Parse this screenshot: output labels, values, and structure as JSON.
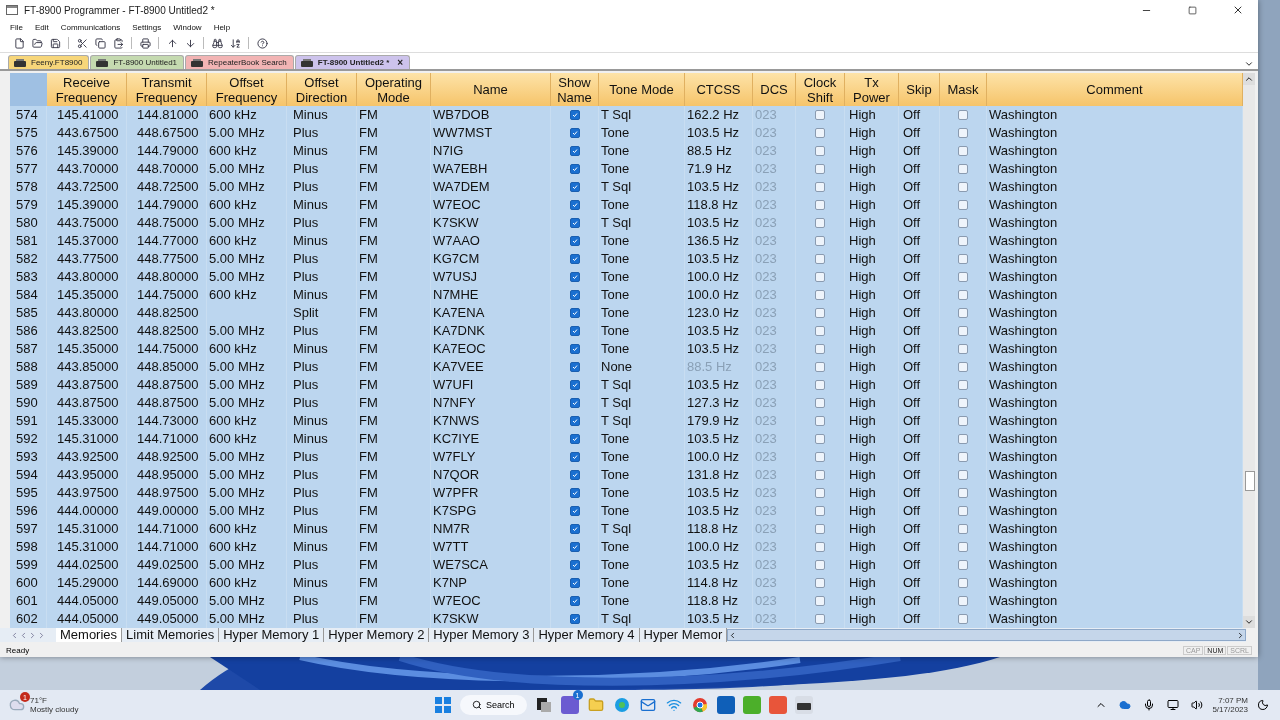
{
  "window": {
    "title": "FT-8900 Programmer - FT-8900 Untitled2 *"
  },
  "menu": [
    "File",
    "Edit",
    "Communications",
    "Settings",
    "Window",
    "Help"
  ],
  "doc_tabs": [
    {
      "label": "Feeny.FT8900",
      "color": "#f7d67a",
      "selected": false,
      "closable": false
    },
    {
      "label": "FT-8900 Untitled1",
      "color": "#c5dab0",
      "selected": false,
      "closable": false
    },
    {
      "label": "RepeaterBook Search",
      "color": "#f2b4b4",
      "selected": false,
      "closable": false
    },
    {
      "label": "FT-8900 Untitled2 *",
      "color": "#cdc3ec",
      "selected": true,
      "closable": true,
      "close": "×"
    }
  ],
  "table": {
    "columns": [
      "Receive Frequency",
      "Transmit Frequency",
      "Offset Frequency",
      "Offset Direction",
      "Operating Mode",
      "Name",
      "Show Name",
      "Tone Mode",
      "CTCSS",
      "DCS",
      "Clock Shift",
      "Tx Power",
      "Skip",
      "Mask",
      "Comment"
    ],
    "rows": [
      {
        "num": "574",
        "rx": "145.41000",
        "tx": "144.81000",
        "offset": "600 kHz",
        "direction": "Minus",
        "mode": "FM",
        "name": "WB7DOB",
        "show_name": true,
        "tone_mode": "T Sql",
        "ctcss": "162.2 Hz",
        "ctcss_enabled": true,
        "dcs": "023",
        "dcs_enabled": false,
        "clock_shift": false,
        "power": "High",
        "skip": "Off",
        "mask": false,
        "comment": "Washington"
      },
      {
        "num": "575",
        "rx": "443.67500",
        "tx": "448.67500",
        "offset": "5.00 MHz",
        "direction": "Plus",
        "mode": "FM",
        "name": "WW7MST",
        "show_name": true,
        "tone_mode": "Tone",
        "ctcss": "103.5 Hz",
        "ctcss_enabled": true,
        "dcs": "023",
        "dcs_enabled": false,
        "clock_shift": false,
        "power": "High",
        "skip": "Off",
        "mask": false,
        "comment": "Washington"
      },
      {
        "num": "576",
        "rx": "145.39000",
        "tx": "144.79000",
        "offset": "600 kHz",
        "direction": "Minus",
        "mode": "FM",
        "name": "N7IG",
        "show_name": true,
        "tone_mode": "Tone",
        "ctcss": "88.5 Hz",
        "ctcss_enabled": true,
        "dcs": "023",
        "dcs_enabled": false,
        "clock_shift": false,
        "power": "High",
        "skip": "Off",
        "mask": false,
        "comment": "Washington"
      },
      {
        "num": "577",
        "rx": "443.70000",
        "tx": "448.70000",
        "offset": "5.00 MHz",
        "direction": "Plus",
        "mode": "FM",
        "name": "WA7EBH",
        "show_name": true,
        "tone_mode": "Tone",
        "ctcss": "71.9 Hz",
        "ctcss_enabled": true,
        "dcs": "023",
        "dcs_enabled": false,
        "clock_shift": false,
        "power": "High",
        "skip": "Off",
        "mask": false,
        "comment": "Washington"
      },
      {
        "num": "578",
        "rx": "443.72500",
        "tx": "448.72500",
        "offset": "5.00 MHz",
        "direction": "Plus",
        "mode": "FM",
        "name": "WA7DEM",
        "show_name": true,
        "tone_mode": "T Sql",
        "ctcss": "103.5 Hz",
        "ctcss_enabled": true,
        "dcs": "023",
        "dcs_enabled": false,
        "clock_shift": false,
        "power": "High",
        "skip": "Off",
        "mask": false,
        "comment": "Washington"
      },
      {
        "num": "579",
        "rx": "145.39000",
        "tx": "144.79000",
        "offset": "600 kHz",
        "direction": "Minus",
        "mode": "FM",
        "name": "W7EOC",
        "show_name": true,
        "tone_mode": "Tone",
        "ctcss": "118.8 Hz",
        "ctcss_enabled": true,
        "dcs": "023",
        "dcs_enabled": false,
        "clock_shift": false,
        "power": "High",
        "skip": "Off",
        "mask": false,
        "comment": "Washington"
      },
      {
        "num": "580",
        "rx": "443.75000",
        "tx": "448.75000",
        "offset": "5.00 MHz",
        "direction": "Plus",
        "mode": "FM",
        "name": "K7SKW",
        "show_name": true,
        "tone_mode": "T Sql",
        "ctcss": "103.5 Hz",
        "ctcss_enabled": true,
        "dcs": "023",
        "dcs_enabled": false,
        "clock_shift": false,
        "power": "High",
        "skip": "Off",
        "mask": false,
        "comment": "Washington"
      },
      {
        "num": "581",
        "rx": "145.37000",
        "tx": "144.77000",
        "offset": "600 kHz",
        "direction": "Minus",
        "mode": "FM",
        "name": "W7AAO",
        "show_name": true,
        "tone_mode": "Tone",
        "ctcss": "136.5 Hz",
        "ctcss_enabled": true,
        "dcs": "023",
        "dcs_enabled": false,
        "clock_shift": false,
        "power": "High",
        "skip": "Off",
        "mask": false,
        "comment": "Washington"
      },
      {
        "num": "582",
        "rx": "443.77500",
        "tx": "448.77500",
        "offset": "5.00 MHz",
        "direction": "Plus",
        "mode": "FM",
        "name": "KG7CM",
        "show_name": true,
        "tone_mode": "Tone",
        "ctcss": "103.5 Hz",
        "ctcss_enabled": true,
        "dcs": "023",
        "dcs_enabled": false,
        "clock_shift": false,
        "power": "High",
        "skip": "Off",
        "mask": false,
        "comment": "Washington"
      },
      {
        "num": "583",
        "rx": "443.80000",
        "tx": "448.80000",
        "offset": "5.00 MHz",
        "direction": "Plus",
        "mode": "FM",
        "name": "W7USJ",
        "show_name": true,
        "tone_mode": "Tone",
        "ctcss": "100.0 Hz",
        "ctcss_enabled": true,
        "dcs": "023",
        "dcs_enabled": false,
        "clock_shift": false,
        "power": "High",
        "skip": "Off",
        "mask": false,
        "comment": "Washington"
      },
      {
        "num": "584",
        "rx": "145.35000",
        "tx": "144.75000",
        "offset": "600 kHz",
        "direction": "Minus",
        "mode": "FM",
        "name": "N7MHE",
        "show_name": true,
        "tone_mode": "Tone",
        "ctcss": "100.0 Hz",
        "ctcss_enabled": true,
        "dcs": "023",
        "dcs_enabled": false,
        "clock_shift": false,
        "power": "High",
        "skip": "Off",
        "mask": false,
        "comment": "Washington"
      },
      {
        "num": "585",
        "rx": "443.80000",
        "tx": "448.82500",
        "direction": "Split",
        "mode": "FM",
        "name": "KA7ENA",
        "show_name": true,
        "tone_mode": "Tone",
        "ctcss": "123.0 Hz",
        "ctcss_enabled": true,
        "dcs": "023",
        "dcs_enabled": false,
        "clock_shift": false,
        "power": "High",
        "skip": "Off",
        "mask": false,
        "comment": "Washington"
      },
      {
        "num": "586",
        "rx": "443.82500",
        "tx": "448.82500",
        "offset": "5.00 MHz",
        "direction": "Plus",
        "mode": "FM",
        "name": "KA7DNK",
        "show_name": true,
        "tone_mode": "Tone",
        "ctcss": "103.5 Hz",
        "ctcss_enabled": true,
        "dcs": "023",
        "dcs_enabled": false,
        "clock_shift": false,
        "power": "High",
        "skip": "Off",
        "mask": false,
        "comment": "Washington"
      },
      {
        "num": "587",
        "rx": "145.35000",
        "tx": "144.75000",
        "offset": "600 kHz",
        "direction": "Minus",
        "mode": "FM",
        "name": "KA7EOC",
        "show_name": true,
        "tone_mode": "Tone",
        "ctcss": "103.5 Hz",
        "ctcss_enabled": true,
        "dcs": "023",
        "dcs_enabled": false,
        "clock_shift": false,
        "power": "High",
        "skip": "Off",
        "mask": false,
        "comment": "Washington"
      },
      {
        "num": "588",
        "rx": "443.85000",
        "tx": "448.85000",
        "offset": "5.00 MHz",
        "direction": "Plus",
        "mode": "FM",
        "name": "KA7VEE",
        "show_name": true,
        "tone_mode": "None",
        "ctcss": "88.5 Hz",
        "ctcss_enabled": false,
        "dcs": "023",
        "dcs_enabled": false,
        "clock_shift": false,
        "power": "High",
        "skip": "Off",
        "mask": false,
        "comment": "Washington"
      },
      {
        "num": "589",
        "rx": "443.87500",
        "tx": "448.87500",
        "offset": "5.00 MHz",
        "direction": "Plus",
        "mode": "FM",
        "name": "W7UFI",
        "show_name": true,
        "tone_mode": "T Sql",
        "ctcss": "103.5 Hz",
        "ctcss_enabled": true,
        "dcs": "023",
        "dcs_enabled": false,
        "clock_shift": false,
        "power": "High",
        "skip": "Off",
        "mask": false,
        "comment": "Washington"
      },
      {
        "num": "590",
        "rx": "443.87500",
        "tx": "448.87500",
        "offset": "5.00 MHz",
        "direction": "Plus",
        "mode": "FM",
        "name": "N7NFY",
        "show_name": true,
        "tone_mode": "T Sql",
        "ctcss": "127.3 Hz",
        "ctcss_enabled": true,
        "dcs": "023",
        "dcs_enabled": false,
        "clock_shift": false,
        "power": "High",
        "skip": "Off",
        "mask": false,
        "comment": "Washington"
      },
      {
        "num": "591",
        "rx": "145.33000",
        "tx": "144.73000",
        "offset": "600 kHz",
        "direction": "Minus",
        "mode": "FM",
        "name": "K7NWS",
        "show_name": true,
        "tone_mode": "T Sql",
        "ctcss": "179.9 Hz",
        "ctcss_enabled": true,
        "dcs": "023",
        "dcs_enabled": false,
        "clock_shift": false,
        "power": "High",
        "skip": "Off",
        "mask": false,
        "comment": "Washington"
      },
      {
        "num": "592",
        "rx": "145.31000",
        "tx": "144.71000",
        "offset": "600 kHz",
        "direction": "Minus",
        "mode": "FM",
        "name": "KC7IYE",
        "show_name": true,
        "tone_mode": "Tone",
        "ctcss": "103.5 Hz",
        "ctcss_enabled": true,
        "dcs": "023",
        "dcs_enabled": false,
        "clock_shift": false,
        "power": "High",
        "skip": "Off",
        "mask": false,
        "comment": "Washington"
      },
      {
        "num": "593",
        "rx": "443.92500",
        "tx": "448.92500",
        "offset": "5.00 MHz",
        "direction": "Plus",
        "mode": "FM",
        "name": "W7FLY",
        "show_name": true,
        "tone_mode": "Tone",
        "ctcss": "100.0 Hz",
        "ctcss_enabled": true,
        "dcs": "023",
        "dcs_enabled": false,
        "clock_shift": false,
        "power": "High",
        "skip": "Off",
        "mask": false,
        "comment": "Washington"
      },
      {
        "num": "594",
        "rx": "443.95000",
        "tx": "448.95000",
        "offset": "5.00 MHz",
        "direction": "Plus",
        "mode": "FM",
        "name": "N7QOR",
        "show_name": true,
        "tone_mode": "Tone",
        "ctcss": "131.8 Hz",
        "ctcss_enabled": true,
        "dcs": "023",
        "dcs_enabled": false,
        "clock_shift": false,
        "power": "High",
        "skip": "Off",
        "mask": false,
        "comment": "Washington"
      },
      {
        "num": "595",
        "rx": "443.97500",
        "tx": "448.97500",
        "offset": "5.00 MHz",
        "direction": "Plus",
        "mode": "FM",
        "name": "W7PFR",
        "show_name": true,
        "tone_mode": "Tone",
        "ctcss": "103.5 Hz",
        "ctcss_enabled": true,
        "dcs": "023",
        "dcs_enabled": false,
        "clock_shift": false,
        "power": "High",
        "skip": "Off",
        "mask": false,
        "comment": "Washington"
      },
      {
        "num": "596",
        "rx": "444.00000",
        "tx": "449.00000",
        "offset": "5.00 MHz",
        "direction": "Plus",
        "mode": "FM",
        "name": "K7SPG",
        "show_name": true,
        "tone_mode": "Tone",
        "ctcss": "103.5 Hz",
        "ctcss_enabled": true,
        "dcs": "023",
        "dcs_enabled": false,
        "clock_shift": false,
        "power": "High",
        "skip": "Off",
        "mask": false,
        "comment": "Washington"
      },
      {
        "num": "597",
        "rx": "145.31000",
        "tx": "144.71000",
        "offset": "600 kHz",
        "direction": "Minus",
        "mode": "FM",
        "name": "NM7R",
        "show_name": true,
        "tone_mode": "T Sql",
        "ctcss": "118.8 Hz",
        "ctcss_enabled": true,
        "dcs": "023",
        "dcs_enabled": false,
        "clock_shift": false,
        "power": "High",
        "skip": "Off",
        "mask": false,
        "comment": "Washington"
      },
      {
        "num": "598",
        "rx": "145.31000",
        "tx": "144.71000",
        "offset": "600 kHz",
        "direction": "Minus",
        "mode": "FM",
        "name": "W7TT",
        "show_name": true,
        "tone_mode": "Tone",
        "ctcss": "100.0 Hz",
        "ctcss_enabled": true,
        "dcs": "023",
        "dcs_enabled": false,
        "clock_shift": false,
        "power": "High",
        "skip": "Off",
        "mask": false,
        "comment": "Washington"
      },
      {
        "num": "599",
        "rx": "444.02500",
        "tx": "449.02500",
        "offset": "5.00 MHz",
        "direction": "Plus",
        "mode": "FM",
        "name": "WE7SCA",
        "show_name": true,
        "tone_mode": "Tone",
        "ctcss": "103.5 Hz",
        "ctcss_enabled": true,
        "dcs": "023",
        "dcs_enabled": false,
        "clock_shift": false,
        "power": "High",
        "skip": "Off",
        "mask": false,
        "comment": "Washington"
      },
      {
        "num": "600",
        "rx": "145.29000",
        "tx": "144.69000",
        "offset": "600 kHz",
        "direction": "Minus",
        "mode": "FM",
        "name": "K7NP",
        "show_name": true,
        "tone_mode": "Tone",
        "ctcss": "114.8 Hz",
        "ctcss_enabled": true,
        "dcs": "023",
        "dcs_enabled": false,
        "clock_shift": false,
        "power": "High",
        "skip": "Off",
        "mask": false,
        "comment": "Washington"
      },
      {
        "num": "601",
        "rx": "444.05000",
        "tx": "449.05000",
        "offset": "5.00 MHz",
        "direction": "Plus",
        "mode": "FM",
        "name": "W7EOC",
        "show_name": true,
        "tone_mode": "Tone",
        "ctcss": "118.8 Hz",
        "ctcss_enabled": true,
        "dcs": "023",
        "dcs_enabled": false,
        "clock_shift": false,
        "power": "High",
        "skip": "Off",
        "mask": false,
        "comment": "Washington"
      },
      {
        "num": "602",
        "rx": "444.05000",
        "tx": "449.05000",
        "offset": "5.00 MHz",
        "direction": "Plus",
        "mode": "FM",
        "name": "K7SKW",
        "show_name": true,
        "tone_mode": "T Sql",
        "ctcss": "103.5 Hz",
        "ctcss_enabled": true,
        "dcs": "023",
        "dcs_enabled": false,
        "clock_shift": false,
        "power": "High",
        "skip": "Off",
        "mask": false,
        "comment": "Washington"
      }
    ]
  },
  "sheet_tabs": [
    {
      "label": "Memories",
      "selected": true
    },
    {
      "label": "Limit Memories",
      "selected": false
    },
    {
      "label": "Hyper Memory 1",
      "selected": false
    },
    {
      "label": "Hyper Memory 2",
      "selected": false
    },
    {
      "label": "Hyper Memory 3",
      "selected": false
    },
    {
      "label": "Hyper Memory 4",
      "selected": false
    },
    {
      "label": "Hyper Memor",
      "selected": false
    }
  ],
  "status_bar": {
    "text": "Ready",
    "indicators": [
      {
        "label": "CAP",
        "on": false
      },
      {
        "label": "NUM",
        "on": true
      },
      {
        "label": "SCRL",
        "on": false
      }
    ]
  },
  "taskbar": {
    "weather": {
      "badge": "1",
      "temp": "71°F",
      "condition": "Mostly cloudy"
    },
    "search": "Search",
    "chat_badge": "1",
    "time": "7:07 PM",
    "date": "5/17/2023"
  }
}
